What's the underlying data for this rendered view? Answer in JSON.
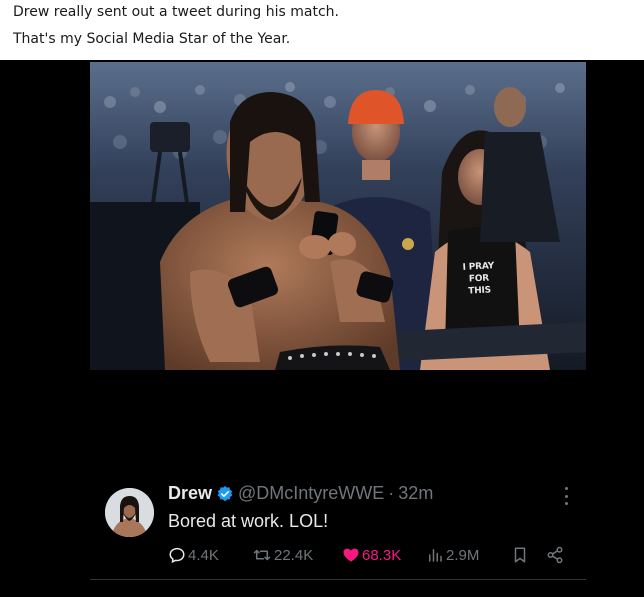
{
  "post": {
    "caption_line1": "Drew really sent out a tweet during his match.",
    "caption_line2": "That's my Social Media Star of the Year."
  },
  "photo": {
    "shirt_text_line1": "I PRAY",
    "shirt_text_line2": "FOR THIS"
  },
  "tweet": {
    "name": "Drew",
    "handle": "@DMcIntyreWWE",
    "separator": "·",
    "time": "32m",
    "text": "Bored at work. LOL!",
    "verified_icon": "verified-badge-icon",
    "replies": "4.4K",
    "reposts": "22.4K",
    "likes": "68.3K",
    "views": "2.9M"
  },
  "colors": {
    "background": "#000000",
    "text": "#e7e9ea",
    "muted": "#71767b",
    "like_pink": "#f91880",
    "verified_blue": "#1d9bf0"
  }
}
